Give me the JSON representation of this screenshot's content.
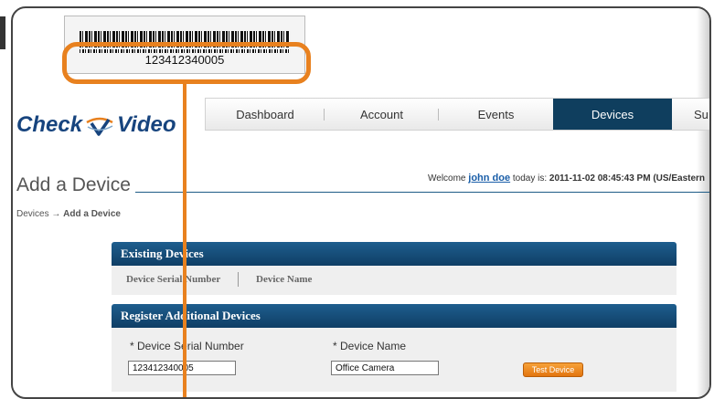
{
  "barcode": {
    "number": "123412340005"
  },
  "logo": {
    "text_left": "Check",
    "text_right": "Video"
  },
  "nav": {
    "tabs": [
      {
        "label": "Dashboard",
        "active": false
      },
      {
        "label": "Account",
        "active": false
      },
      {
        "label": "Events",
        "active": false
      },
      {
        "label": "Devices",
        "active": true
      },
      {
        "label": "Su",
        "active": false
      }
    ]
  },
  "page": {
    "title": "Add a Device",
    "welcome_prefix": "Welcome",
    "user": "john doe",
    "welcome_middle": "today is:",
    "datetime": "2011-11-02 08:45:43 PM (US/Eastern"
  },
  "breadcrumb": {
    "root": "Devices",
    "separator": "→",
    "current": "Add a Device"
  },
  "existing_devices": {
    "title": "Existing Devices",
    "columns": [
      "Device Serial Number",
      "Device Name"
    ]
  },
  "register": {
    "title": "Register Additional Devices",
    "serial_label": "* Device Serial Number",
    "serial_value": "123412340005",
    "name_label": "* Device Name",
    "name_value": "Office Camera",
    "test_button": "Test Device"
  },
  "colors": {
    "accent": "#e8811f",
    "nav_active": "#0f3e5e",
    "panel_header": "#0f3e65",
    "brand": "#17447e"
  }
}
